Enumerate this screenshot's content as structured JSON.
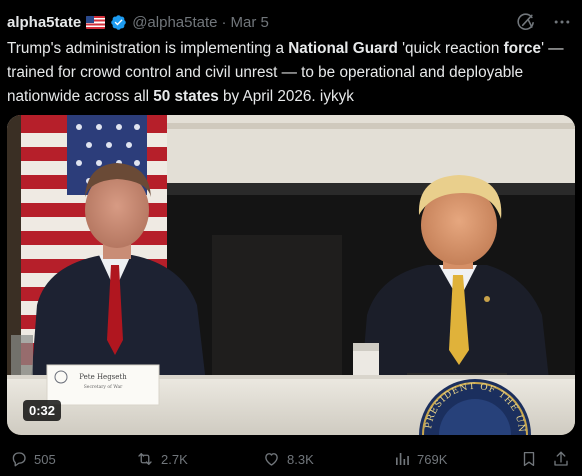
{
  "author": {
    "display_name": "alpha5tate",
    "handle": "@alpha5tate",
    "separator": "·",
    "date": "Mar 5",
    "flag_icon": "us-flag-emoji",
    "verified_color": "#1d9bf0"
  },
  "tweet": {
    "segments": [
      {
        "text": "Trump's administration is implementing a ",
        "bold": false
      },
      {
        "text": "National Guard",
        "bold": true
      },
      {
        "text": " 'quick reaction ",
        "bold": false
      },
      {
        "text": "force",
        "bold": true
      },
      {
        "text": "' — trained for crowd control and civil unrest — to be operational and deployable nationwide across all ",
        "bold": false
      },
      {
        "text": "50 states",
        "bold": true
      },
      {
        "text": " by April 2026. iykyk",
        "bold": false
      }
    ]
  },
  "media": {
    "duration": "0:32",
    "nameplate": {
      "name": "Pete Hegseth",
      "title": "Secretary of War"
    },
    "seal_text": "PRESIDENT OF THE UNITED"
  },
  "actions": {
    "replies": "505",
    "reposts": "2.7K",
    "likes": "8.3K",
    "views": "769K",
    "reply_icon": "reply-icon",
    "repost_icon": "repost-icon",
    "like_icon": "heart-icon",
    "views_icon": "views-icon",
    "grok_icon": "grok-icon",
    "more_icon": "more-icon",
    "bookmark_icon": "bookmark-icon",
    "share_icon": "share-icon"
  },
  "colors": {
    "background": "#000000",
    "text": "#e7e9ea",
    "muted": "#71767b",
    "accent": "#1d9bf0"
  }
}
